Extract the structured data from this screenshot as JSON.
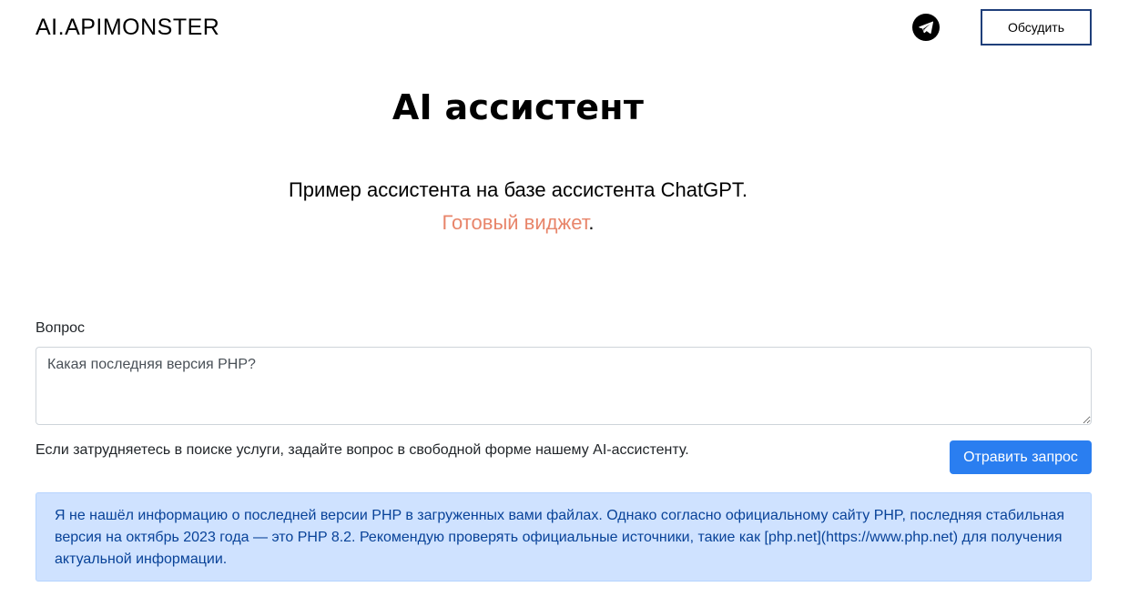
{
  "header": {
    "logo": "AI.APIMONSTER",
    "telegram_icon": "telegram-icon",
    "discuss_label": "Обсудить"
  },
  "hero": {
    "title": "AI ассистент",
    "subtitle": "Пример ассистента на базе ассистента ChatGPT.",
    "widget_link": "Готовый виджет",
    "widget_suffix": "."
  },
  "form": {
    "question_label": "Вопрос",
    "question_value": "Какая последняя версия PHP?",
    "hint": "Если затрудняетесь в поиске услуги, задайте вопрос в свободной форме нашему AI-ассистенту.",
    "submit_label": "Отравить запрос"
  },
  "answer": {
    "text": "Я не нашёл информацию о последней версии PHP в загруженных вами файлах. Однако согласно официальному сайту PHP, последняя стабильная версия на октябрь 2023 года — это PHP 8.2. Рекомендую проверять официальные источники, такие как [php.net](https://www.php.net) для получения актуальной информации."
  },
  "colors": {
    "accent_button": "#2a7ef0",
    "link": "#e8856a",
    "answer_bg": "#cfe2ff",
    "answer_text": "#084298"
  }
}
